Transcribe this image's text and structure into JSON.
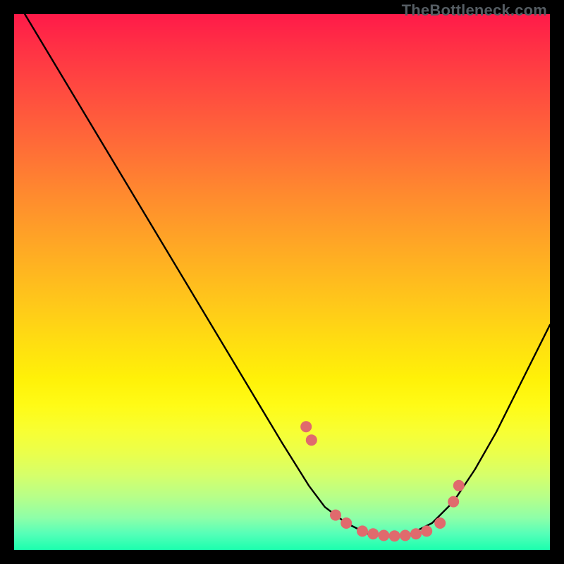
{
  "attribution": "TheBottleneck.com",
  "chart_data": {
    "type": "line",
    "title": "",
    "xlabel": "",
    "ylabel": "",
    "xlim": [
      0,
      100
    ],
    "ylim": [
      0,
      100
    ],
    "grid": false,
    "legend": false,
    "annotations": [],
    "series": [
      {
        "name": "bottleneck-curve",
        "color": "#000000",
        "x_percent": [
          2,
          8,
          14,
          20,
          26,
          32,
          38,
          44,
          50,
          55,
          58,
          62,
          66,
          70,
          74,
          78,
          82,
          86,
          90,
          94,
          100
        ],
        "y_percent": [
          100,
          90,
          80,
          70,
          60,
          50,
          40,
          30,
          20,
          12,
          8,
          5,
          3,
          2.5,
          3,
          5,
          9,
          15,
          22,
          30,
          42
        ]
      }
    ],
    "marker_points": {
      "name": "highlight-dots",
      "color": "#e06a6d",
      "x_percent": [
        54.5,
        55.5,
        60,
        62,
        65,
        67,
        69,
        71,
        73,
        75,
        77,
        79.5,
        82,
        83
      ],
      "y_percent": [
        23,
        20.5,
        6.5,
        5,
        3.5,
        3,
        2.7,
        2.6,
        2.7,
        3,
        3.5,
        5,
        9,
        12
      ]
    },
    "notes": "x and y are expressed as percent of the plot area; y=0 is the bottom edge. Values are read from the image geometry, not labeled axes."
  }
}
